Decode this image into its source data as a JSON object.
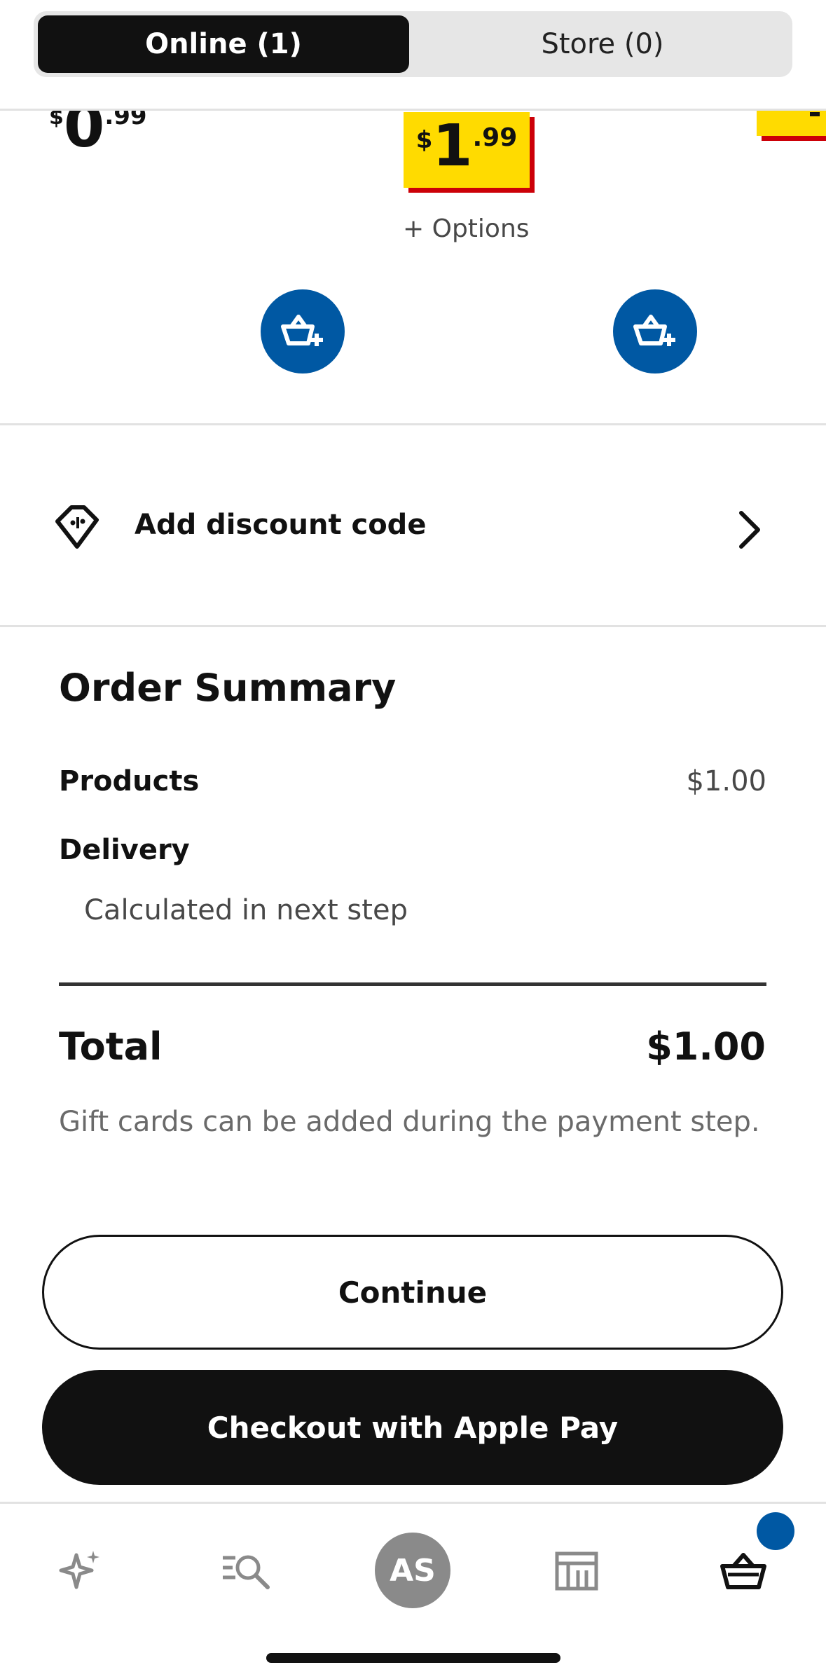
{
  "tabs": {
    "online_label": "Online (1)",
    "store_label": "Store (0)"
  },
  "products": {
    "price1": {
      "currency": "$",
      "integer": "0",
      "decimal": ".99"
    },
    "price2": {
      "currency": "$",
      "integer": "1",
      "decimal": ".99"
    },
    "options_label": "+ Options"
  },
  "discount": {
    "label": "Add discount code"
  },
  "summary": {
    "title": "Order Summary",
    "products_label": "Products",
    "products_value": "$1.00",
    "delivery_label": "Delivery",
    "delivery_note": "Calculated in next step",
    "total_label": "Total",
    "total_value": "$1.00",
    "gift_note": "Gift cards can be added during the payment step."
  },
  "actions": {
    "continue_label": "Continue",
    "apple_pay_label": "Checkout with Apple Pay"
  },
  "nav": {
    "avatar_initials": "AS",
    "items": [
      "sparkle-icon",
      "search-list-icon",
      "avatar",
      "store-icon",
      "basket-icon"
    ]
  },
  "colors": {
    "brand_blue": "#0058a3",
    "price_yellow": "#ffdb00",
    "price_red": "#cc0008"
  }
}
